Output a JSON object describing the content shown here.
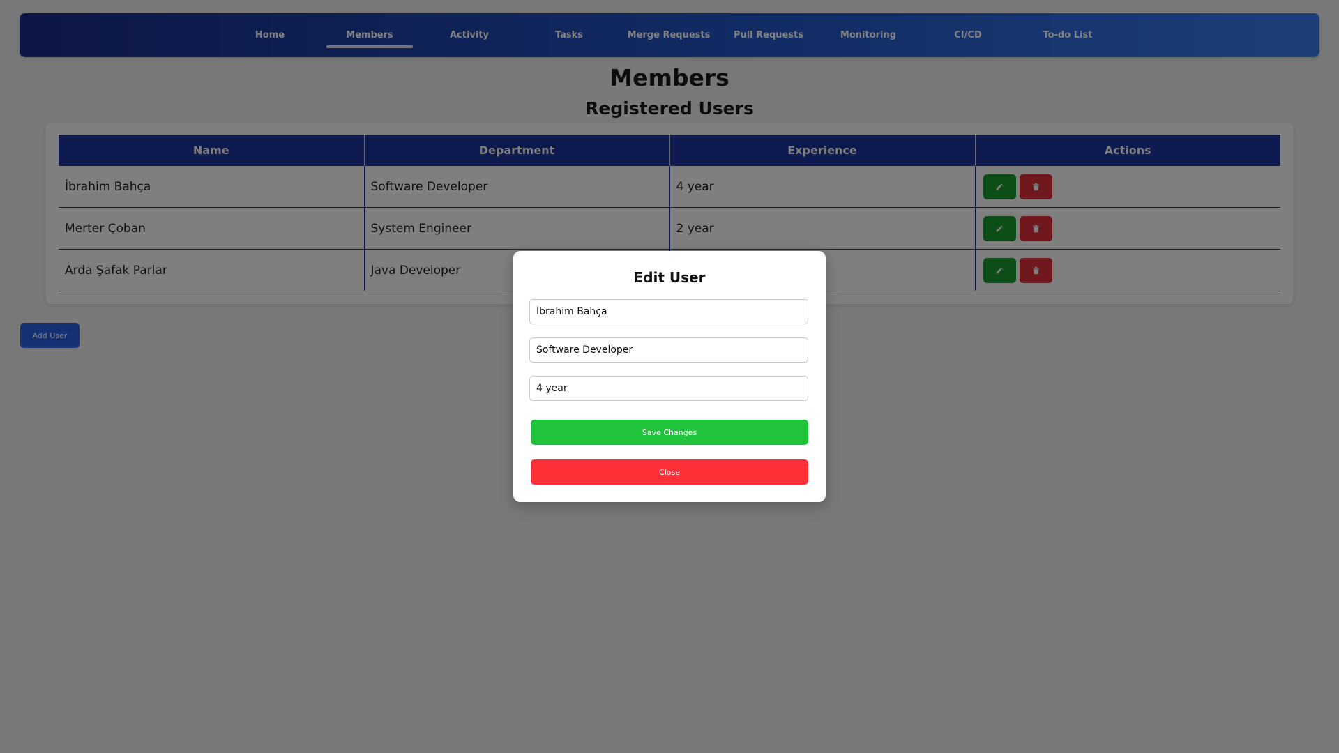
{
  "nav": {
    "items": [
      {
        "label": "Home",
        "active": false
      },
      {
        "label": "Members",
        "active": true
      },
      {
        "label": "Activity",
        "active": false
      },
      {
        "label": "Tasks",
        "active": false
      },
      {
        "label": "Merge Requests",
        "active": false
      },
      {
        "label": "Pull Requests",
        "active": false
      },
      {
        "label": "Monitoring",
        "active": false
      },
      {
        "label": "CI/CD",
        "active": false
      },
      {
        "label": "To-do List",
        "active": false
      }
    ]
  },
  "page": {
    "title": "Members",
    "subtitle": "Registered Users"
  },
  "table": {
    "headers": [
      "Name",
      "Department",
      "Experience",
      "Actions"
    ],
    "rows": [
      {
        "name": "İbrahim Bahça",
        "department": "Software Developer",
        "experience": "4 year"
      },
      {
        "name": "Merter Çoban",
        "department": "System Engineer",
        "experience": "2 year"
      },
      {
        "name": "Arda Şafak Parlar",
        "department": "Java Developer",
        "experience": ""
      }
    ],
    "actions": {
      "edit_icon": "pencil-icon",
      "delete_icon": "trash-icon"
    }
  },
  "add_user_label": "Add User",
  "modal": {
    "title": "Edit User",
    "name_value": "İbrahim Bahça",
    "department_value": "Software Developer",
    "experience_value": "4 year",
    "save_label": "Save Changes",
    "close_label": "Close"
  },
  "colors": {
    "nav_gradient_start": "#1a2d8a",
    "nav_gradient_end": "#3a7ef0",
    "table_header": "#1d34a0",
    "edit_button": "#1a9a2f",
    "delete_button": "#e0303a",
    "save_button": "#1fc43c",
    "close_button": "#ff2f37",
    "add_user_button": "#2a63e8"
  }
}
